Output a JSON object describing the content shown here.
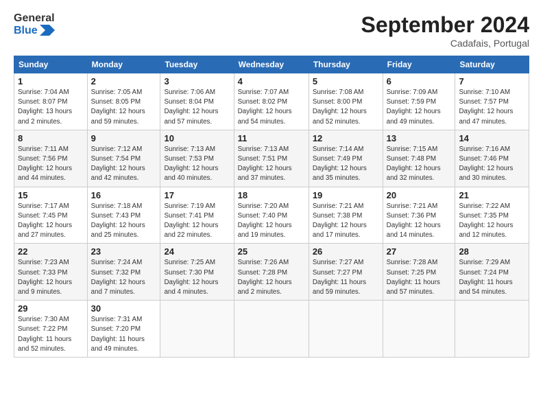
{
  "header": {
    "logo_text_general": "General",
    "logo_text_blue": "Blue",
    "month_title": "September 2024",
    "location": "Cadafais, Portugal"
  },
  "calendar": {
    "days_of_week": [
      "Sunday",
      "Monday",
      "Tuesday",
      "Wednesday",
      "Thursday",
      "Friday",
      "Saturday"
    ],
    "weeks": [
      [
        {
          "day": "1",
          "info": "Sunrise: 7:04 AM\nSunset: 8:07 PM\nDaylight: 13 hours\nand 2 minutes."
        },
        {
          "day": "2",
          "info": "Sunrise: 7:05 AM\nSunset: 8:05 PM\nDaylight: 12 hours\nand 59 minutes."
        },
        {
          "day": "3",
          "info": "Sunrise: 7:06 AM\nSunset: 8:04 PM\nDaylight: 12 hours\nand 57 minutes."
        },
        {
          "day": "4",
          "info": "Sunrise: 7:07 AM\nSunset: 8:02 PM\nDaylight: 12 hours\nand 54 minutes."
        },
        {
          "day": "5",
          "info": "Sunrise: 7:08 AM\nSunset: 8:00 PM\nDaylight: 12 hours\nand 52 minutes."
        },
        {
          "day": "6",
          "info": "Sunrise: 7:09 AM\nSunset: 7:59 PM\nDaylight: 12 hours\nand 49 minutes."
        },
        {
          "day": "7",
          "info": "Sunrise: 7:10 AM\nSunset: 7:57 PM\nDaylight: 12 hours\nand 47 minutes."
        }
      ],
      [
        {
          "day": "8",
          "info": "Sunrise: 7:11 AM\nSunset: 7:56 PM\nDaylight: 12 hours\nand 44 minutes."
        },
        {
          "day": "9",
          "info": "Sunrise: 7:12 AM\nSunset: 7:54 PM\nDaylight: 12 hours\nand 42 minutes."
        },
        {
          "day": "10",
          "info": "Sunrise: 7:13 AM\nSunset: 7:53 PM\nDaylight: 12 hours\nand 40 minutes."
        },
        {
          "day": "11",
          "info": "Sunrise: 7:13 AM\nSunset: 7:51 PM\nDaylight: 12 hours\nand 37 minutes."
        },
        {
          "day": "12",
          "info": "Sunrise: 7:14 AM\nSunset: 7:49 PM\nDaylight: 12 hours\nand 35 minutes."
        },
        {
          "day": "13",
          "info": "Sunrise: 7:15 AM\nSunset: 7:48 PM\nDaylight: 12 hours\nand 32 minutes."
        },
        {
          "day": "14",
          "info": "Sunrise: 7:16 AM\nSunset: 7:46 PM\nDaylight: 12 hours\nand 30 minutes."
        }
      ],
      [
        {
          "day": "15",
          "info": "Sunrise: 7:17 AM\nSunset: 7:45 PM\nDaylight: 12 hours\nand 27 minutes."
        },
        {
          "day": "16",
          "info": "Sunrise: 7:18 AM\nSunset: 7:43 PM\nDaylight: 12 hours\nand 25 minutes."
        },
        {
          "day": "17",
          "info": "Sunrise: 7:19 AM\nSunset: 7:41 PM\nDaylight: 12 hours\nand 22 minutes."
        },
        {
          "day": "18",
          "info": "Sunrise: 7:20 AM\nSunset: 7:40 PM\nDaylight: 12 hours\nand 19 minutes."
        },
        {
          "day": "19",
          "info": "Sunrise: 7:21 AM\nSunset: 7:38 PM\nDaylight: 12 hours\nand 17 minutes."
        },
        {
          "day": "20",
          "info": "Sunrise: 7:21 AM\nSunset: 7:36 PM\nDaylight: 12 hours\nand 14 minutes."
        },
        {
          "day": "21",
          "info": "Sunrise: 7:22 AM\nSunset: 7:35 PM\nDaylight: 12 hours\nand 12 minutes."
        }
      ],
      [
        {
          "day": "22",
          "info": "Sunrise: 7:23 AM\nSunset: 7:33 PM\nDaylight: 12 hours\nand 9 minutes."
        },
        {
          "day": "23",
          "info": "Sunrise: 7:24 AM\nSunset: 7:32 PM\nDaylight: 12 hours\nand 7 minutes."
        },
        {
          "day": "24",
          "info": "Sunrise: 7:25 AM\nSunset: 7:30 PM\nDaylight: 12 hours\nand 4 minutes."
        },
        {
          "day": "25",
          "info": "Sunrise: 7:26 AM\nSunset: 7:28 PM\nDaylight: 12 hours\nand 2 minutes."
        },
        {
          "day": "26",
          "info": "Sunrise: 7:27 AM\nSunset: 7:27 PM\nDaylight: 11 hours\nand 59 minutes."
        },
        {
          "day": "27",
          "info": "Sunrise: 7:28 AM\nSunset: 7:25 PM\nDaylight: 11 hours\nand 57 minutes."
        },
        {
          "day": "28",
          "info": "Sunrise: 7:29 AM\nSunset: 7:24 PM\nDaylight: 11 hours\nand 54 minutes."
        }
      ],
      [
        {
          "day": "29",
          "info": "Sunrise: 7:30 AM\nSunset: 7:22 PM\nDaylight: 11 hours\nand 52 minutes."
        },
        {
          "day": "30",
          "info": "Sunrise: 7:31 AM\nSunset: 7:20 PM\nDaylight: 11 hours\nand 49 minutes."
        },
        {
          "day": "",
          "info": ""
        },
        {
          "day": "",
          "info": ""
        },
        {
          "day": "",
          "info": ""
        },
        {
          "day": "",
          "info": ""
        },
        {
          "day": "",
          "info": ""
        }
      ]
    ]
  }
}
